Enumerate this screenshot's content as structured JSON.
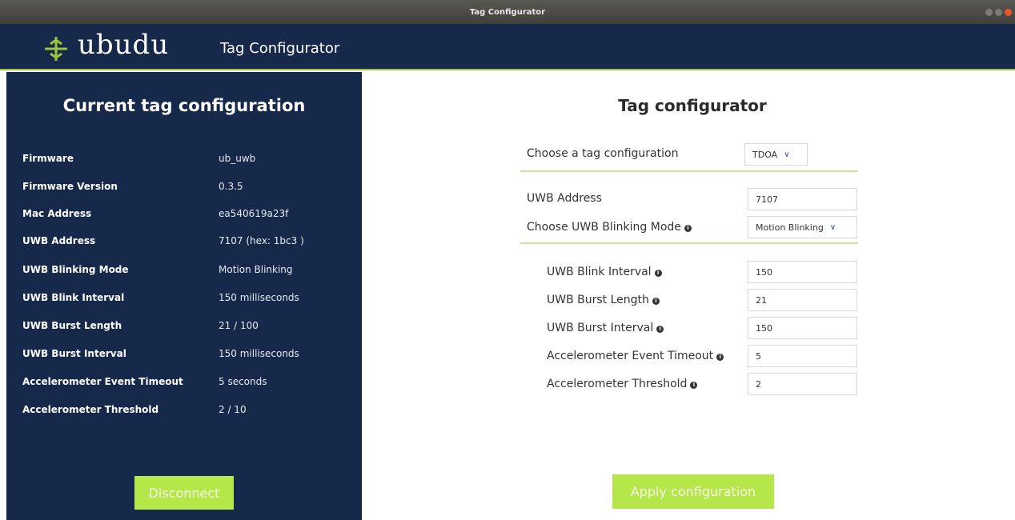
{
  "window": {
    "title": "Tag Configurator"
  },
  "header": {
    "logo_text": "ubudu",
    "app_title": "Tag Configurator"
  },
  "left": {
    "heading": "Current tag configuration",
    "rows": [
      {
        "label": "Firmware",
        "value": "ub_uwb"
      },
      {
        "label": "Firmware Version",
        "value": "0.3.5"
      },
      {
        "label": "Mac Address",
        "value": "ea540619a23f"
      },
      {
        "label": "UWB Address",
        "value": "7107 (hex: 1bc3 )"
      },
      {
        "label": "UWB Blinking Mode",
        "value": "Motion Blinking"
      },
      {
        "label": "UWB Blink Interval",
        "value": "150 milliseconds"
      },
      {
        "label": "UWB Burst Length",
        "value": "21 / 100"
      },
      {
        "label": "UWB Burst Interval",
        "value": "150 milliseconds"
      },
      {
        "label": "Accelerometer Event Timeout",
        "value": "5 seconds"
      },
      {
        "label": "Accelerometer Threshold",
        "value": "2 / 10"
      }
    ],
    "disconnect_label": "Disconnect"
  },
  "right": {
    "heading": "Tag configurator",
    "tag_config": {
      "label": "Choose a tag configuration",
      "selected": "TDOA"
    },
    "uwb_address": {
      "label": "UWB Address",
      "value": "7107"
    },
    "blinking_mode": {
      "label": "Choose UWB Blinking Mode",
      "selected": "Motion Blinking"
    },
    "blink_interval": {
      "label": "UWB Blink Interval",
      "value": "150"
    },
    "burst_length": {
      "label": "UWB Burst Length",
      "value": "21"
    },
    "burst_interval": {
      "label": "UWB Burst Interval",
      "value": "150"
    },
    "accel_timeout": {
      "label": "Accelerometer Event Timeout",
      "value": "5"
    },
    "accel_threshold": {
      "label": "Accelerometer Threshold",
      "value": "2"
    },
    "apply_label": "Apply configuration"
  },
  "colors": {
    "navy": "#16294a",
    "accent_green": "#b5e64a",
    "divider_green": "#c9e39a"
  }
}
